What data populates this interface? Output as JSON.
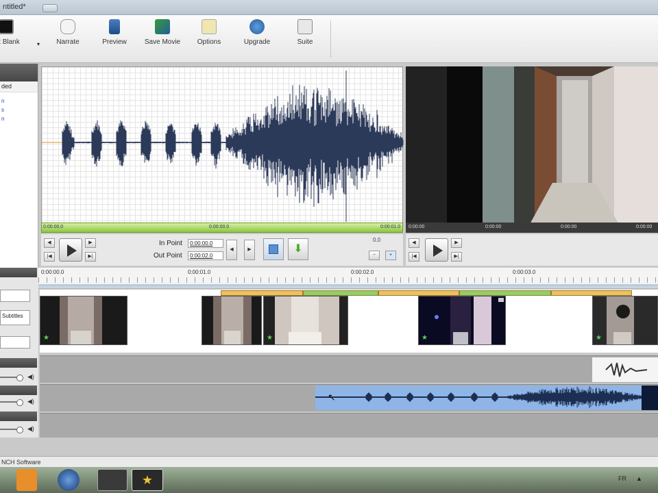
{
  "window": {
    "title": "ntitled*"
  },
  "toolbar": {
    "items": [
      {
        "label": "ert Blank",
        "icon": "blank-clip-icon"
      },
      {
        "label": "Narrate",
        "icon": "narrate-icon"
      },
      {
        "label": "Preview",
        "icon": "preview-icon"
      },
      {
        "label": "Save Movie",
        "icon": "save-movie-icon"
      },
      {
        "label": "Options",
        "icon": "options-icon"
      },
      {
        "label": "Upgrade",
        "icon": "upgrade-icon"
      },
      {
        "label": "Suite",
        "icon": "suite-icon"
      }
    ]
  },
  "left_panel": {
    "header_row": "ded",
    "items": [
      "n",
      "s",
      "n"
    ]
  },
  "clip_editor": {
    "green_bar_labels": [
      "0:00:00.0",
      "0:00:00.0",
      "0:00:01.0"
    ],
    "in_point_label": "In Point",
    "in_point_value": "0:00:00.0",
    "out_point_label": "Out Point",
    "out_point_value": "0:00:02.0",
    "zoom_label": "0.0"
  },
  "preview": {
    "bar_labels": [
      "0:00:00",
      "0:00:00",
      "0:00:00",
      "0:00:00"
    ]
  },
  "timeline": {
    "ruler_ticks": [
      "0:00:00.0",
      "0:00:01.0",
      "0:00:02.0",
      "0:00:03.0"
    ],
    "left_controls": {
      "subtitles_label": "Subtitles"
    }
  },
  "status": {
    "text": "NCH Software"
  },
  "tray": {
    "lang": "FR"
  }
}
